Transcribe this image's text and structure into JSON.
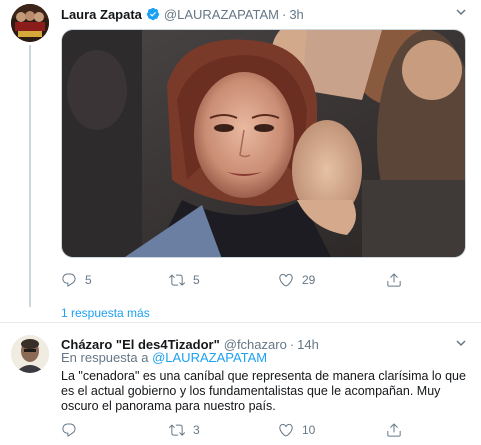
{
  "tweet1": {
    "name": "Laura Zapata",
    "handle": "@LAURAZAPATAM",
    "separator": "·",
    "time": "3h",
    "replies": "5",
    "retweets": "5",
    "likes": "29",
    "more_replies": "1 respuesta más",
    "icons": [
      "verified-icon",
      "caret-down-icon",
      "reply-icon",
      "retweet-icon",
      "like-icon",
      "share-icon"
    ]
  },
  "tweet2": {
    "name": "Cházaro \"El des4Tizador\"",
    "handle": "@fchazaro",
    "separator": "·",
    "time": "14h",
    "reply_prefix": "En respuesta a",
    "reply_mention": "@LAURAZAPATAM",
    "text": "La \"cenadora\" es una caníbal que representa de manera clarísima lo que es el actual gobierno y los fundamentalistas que le acompañan. Muy oscuro el panorama para nuestro país.",
    "replies": "",
    "retweets": "3",
    "likes": "10"
  },
  "colors": {
    "accent": "#1da1f2",
    "secondary_text": "#657786",
    "primary_text": "#14171a",
    "like": "#e0245e",
    "retweet": "#17bf63"
  }
}
